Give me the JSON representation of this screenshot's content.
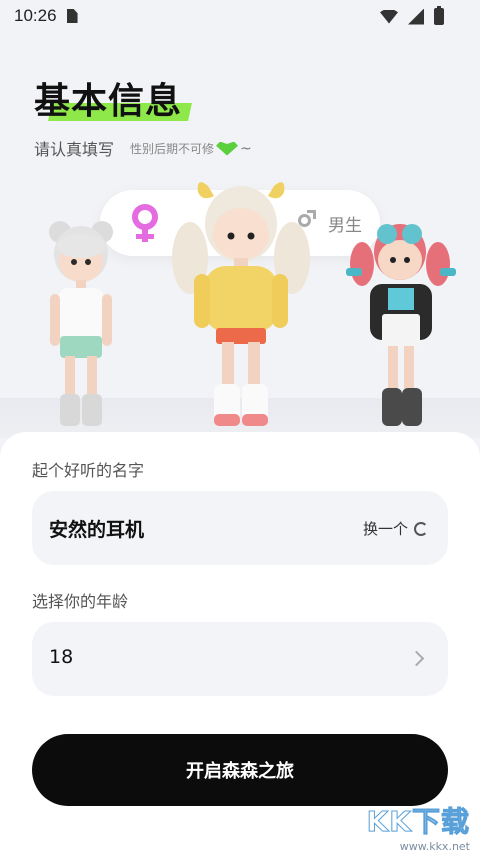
{
  "status_bar": {
    "time": "10:26"
  },
  "header": {
    "title": "基本信息",
    "subtitle": "请认真填写",
    "hint": "性别后期不可修",
    "hint_suffix": "~"
  },
  "gender": {
    "female_label": "女生",
    "male_label": "男生",
    "selected": "female",
    "colors": {
      "female": "#e56be0",
      "male": "#aaaaaa"
    }
  },
  "form": {
    "name_label": "起个好听的名字",
    "name_value": "安然的耳机",
    "swap_label": "换一个",
    "age_label": "选择你的年龄",
    "age_value": "18"
  },
  "start_button": {
    "label": "开启森森之旅"
  },
  "watermark": {
    "logo": "KK下载",
    "url": "www.kkx.net"
  },
  "colors": {
    "accent": "#8ee84a",
    "button": "#0c0c0c",
    "field_bg": "#f3f4f8"
  }
}
